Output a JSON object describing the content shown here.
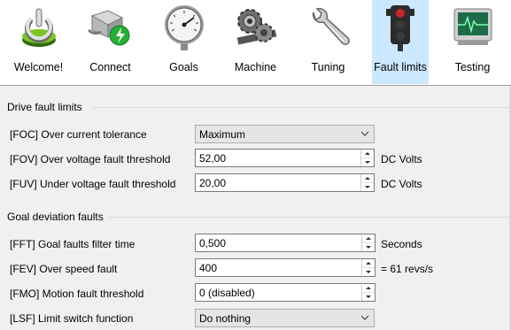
{
  "toolbar": {
    "items": [
      {
        "label": "Welcome!",
        "icon": "power-icon",
        "active": false
      },
      {
        "label": "Connect",
        "icon": "network-plug-icon",
        "active": false
      },
      {
        "label": "Goals",
        "icon": "pressure-gauge-icon",
        "active": false
      },
      {
        "label": "Machine",
        "icon": "gears-icon",
        "active": false
      },
      {
        "label": "Tuning",
        "icon": "wrench-icon",
        "active": false
      },
      {
        "label": "Fault limits",
        "icon": "traffic-light-icon",
        "active": true
      },
      {
        "label": "Testing",
        "icon": "oscilloscope-icon",
        "active": false
      }
    ],
    "active_color": "#cce8ff"
  },
  "drive_faults": {
    "title": "Drive fault limits",
    "foc": {
      "label": "[FOC] Over current tolerance",
      "value": "Maximum"
    },
    "fov": {
      "label": "[FOV] Over voltage fault threshold",
      "value": "52,00",
      "unit": "DC Volts"
    },
    "fuv": {
      "label": "[FUV] Under voltage fault threshold",
      "value": "20,00",
      "unit": "DC Volts"
    }
  },
  "goal_faults": {
    "title": "Goal deviation faults",
    "fft": {
      "label": "[FFT] Goal faults filter time",
      "value": "0,500",
      "unit": "Seconds"
    },
    "fev": {
      "label": "[FEV] Over speed fault",
      "value": "400",
      "unit": "= 61 revs/s"
    },
    "fmo": {
      "label": "[FMO] Motion fault threshold",
      "value": "0 (disabled)"
    },
    "lsf": {
      "label": "[LSF] Limit switch function",
      "value": "Do nothing"
    }
  }
}
